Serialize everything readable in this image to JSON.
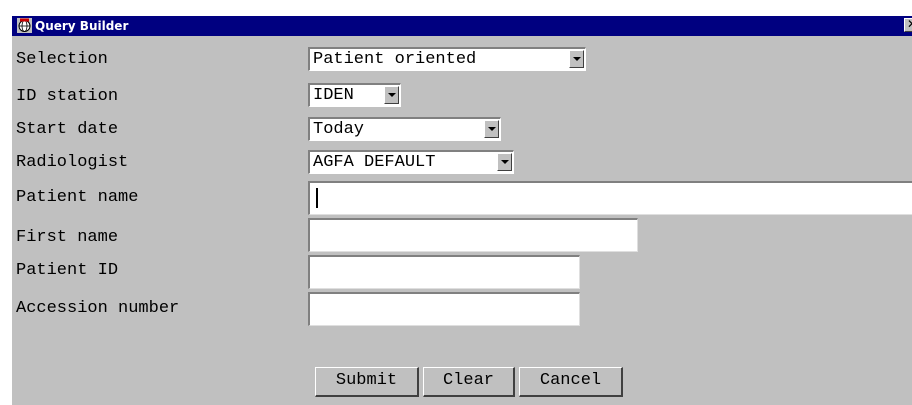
{
  "window": {
    "title": "Query Builder",
    "close_symbol": "✕",
    "app_icon": "globe-icon"
  },
  "form": {
    "labels": {
      "selection": "Selection",
      "id_station": "ID station",
      "start_date": "Start date",
      "radiologist": "Radiologist",
      "patient_name": "Patient name",
      "first_name": "First name",
      "patient_id": "Patient ID",
      "accession_number": "Accession number"
    },
    "values": {
      "selection": "Patient oriented",
      "id_station": "IDEN",
      "start_date": "Today",
      "radiologist": "AGFA DEFAULT",
      "patient_name": "",
      "first_name": "",
      "patient_id": "",
      "accession_number": ""
    }
  },
  "buttons": {
    "submit": "Submit",
    "clear": "Clear",
    "cancel": "Cancel"
  },
  "colors": {
    "titlebar": "#000080",
    "dialog_bg": "#c0c0c0"
  }
}
